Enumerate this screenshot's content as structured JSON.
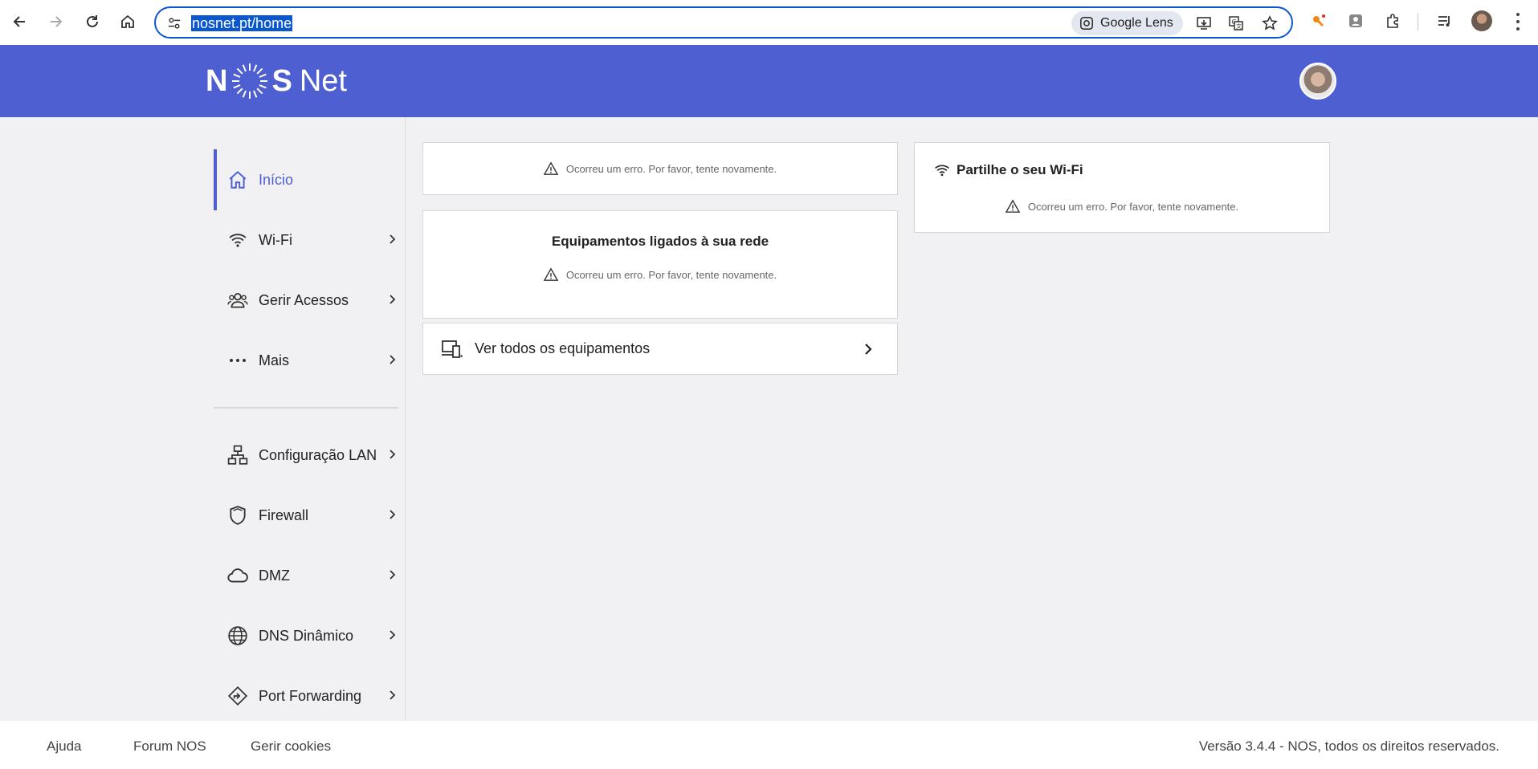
{
  "browser": {
    "url": "nosnet.pt/home",
    "lens_label": "Google Lens"
  },
  "app": {
    "logo_left": "N",
    "logo_right": "S",
    "logo_suffix": "Net",
    "brand_color": "#4e5fd1"
  },
  "sidebar": {
    "items": [
      {
        "label": "Início",
        "icon": "home-icon",
        "active": true
      },
      {
        "label": "Wi-Fi",
        "icon": "wifi-icon"
      },
      {
        "label": "Gerir Acessos",
        "icon": "users-icon"
      },
      {
        "label": "Mais",
        "icon": "more-dots-icon"
      },
      {
        "label": "Configuração LAN",
        "icon": "network-icon"
      },
      {
        "label": "Firewall",
        "icon": "shield-icon"
      },
      {
        "label": "DMZ",
        "icon": "cloud-icon"
      },
      {
        "label": "DNS Dinâmico",
        "icon": "globe-icon"
      },
      {
        "label": "Port Forwarding",
        "icon": "port-forward-icon"
      }
    ]
  },
  "main": {
    "error_text": "Ocorreu um erro. Por favor, tente novamente.",
    "devices_title": "Equipamentos ligados à sua rede",
    "see_all_label": "Ver todos os equipamentos",
    "share_wifi_title": "Partilhe o seu Wi-Fi"
  },
  "footer": {
    "help": "Ajuda",
    "forum": "Forum NOS",
    "cookies": "Gerir cookies",
    "version": "Versão 3.4.4 - NOS, todos os direitos reservados."
  }
}
